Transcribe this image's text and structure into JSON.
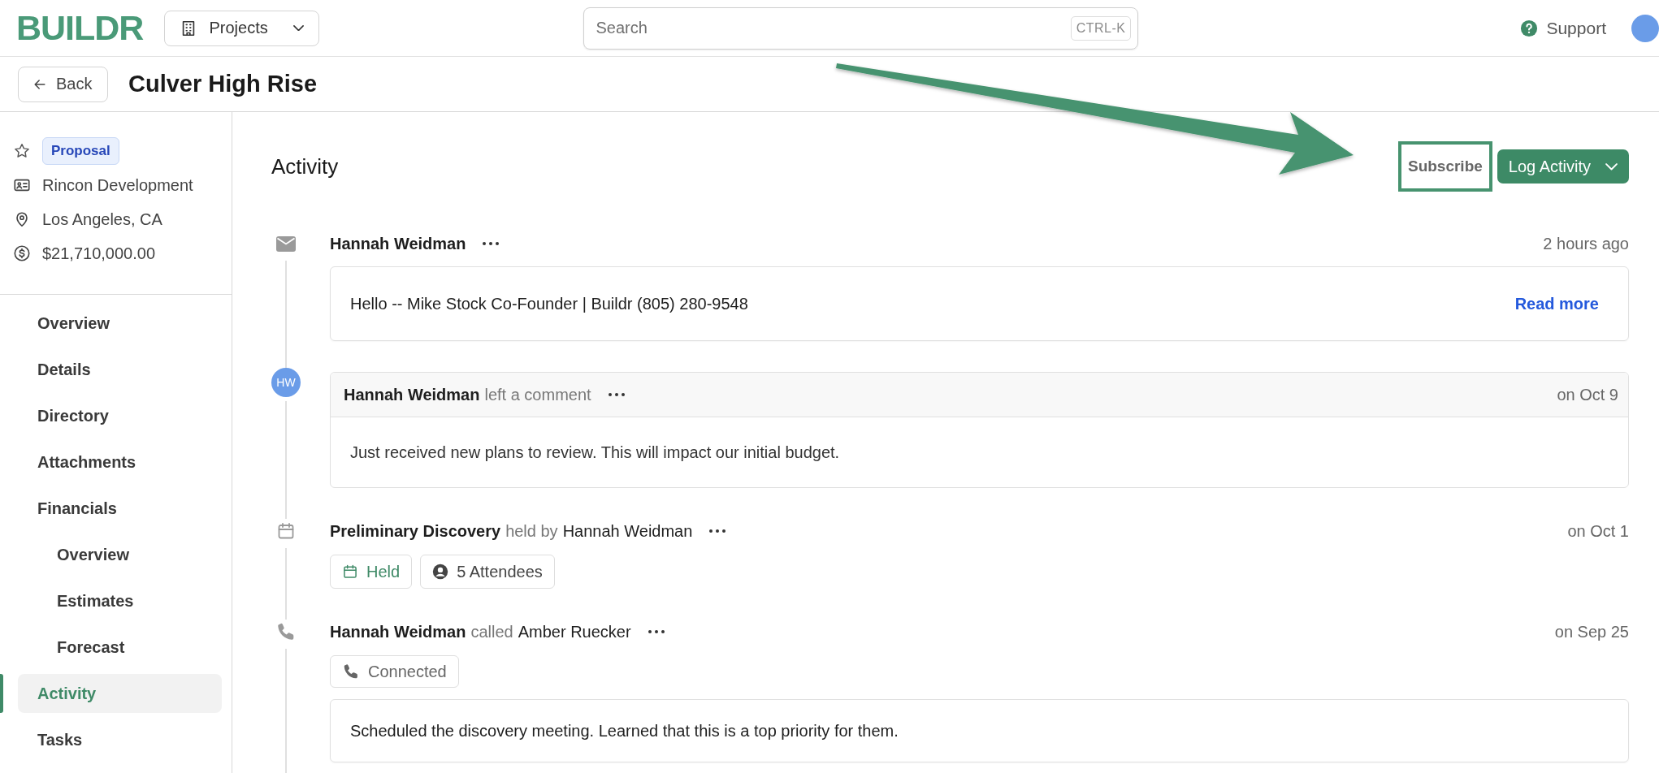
{
  "header": {
    "logo": "BUILDR",
    "projects_menu": "Projects",
    "search": {
      "placeholder": "Search",
      "shortcut": "CTRL-K"
    },
    "support": "Support"
  },
  "page": {
    "back": "Back",
    "title": "Culver High Rise"
  },
  "sidebar": {
    "starred": false,
    "status": "Proposal",
    "company": "Rincon Development",
    "location": "Los Angeles, CA",
    "value": "$21,710,000.00",
    "items": [
      {
        "label": "Overview",
        "selected": false
      },
      {
        "label": "Details",
        "selected": false
      },
      {
        "label": "Directory",
        "selected": false
      },
      {
        "label": "Attachments",
        "selected": false
      },
      {
        "label": "Financials",
        "selected": false,
        "children": [
          {
            "label": "Overview",
            "selected": false
          },
          {
            "label": "Estimates",
            "selected": false
          },
          {
            "label": "Forecast",
            "selected": false
          }
        ]
      },
      {
        "label": "Activity",
        "selected": true
      },
      {
        "label": "Tasks",
        "selected": false
      }
    ]
  },
  "activity": {
    "title": "Activity",
    "subscribe": "Subscribe",
    "log_button": "Log Activity",
    "entries": [
      {
        "kind": "email",
        "author": "Hannah Weidman",
        "time": "2 hours ago",
        "body": "Hello -- Mike Stock Co-Founder | Buildr (805) 280-9548",
        "link": "Read more"
      },
      {
        "kind": "comment",
        "initials": "HW",
        "author": "Hannah Weidman",
        "action": "left a comment",
        "time": "on Oct 9",
        "body": "Just received new plans to review. This will impact our initial budget."
      },
      {
        "kind": "meeting",
        "author": "Preliminary Discovery",
        "action": "held by",
        "person": "Hannah Weidman",
        "time": "on Oct 1",
        "chips": [
          {
            "kind": "held",
            "label": "Held"
          },
          {
            "kind": "attendees",
            "label": "5 Attendees"
          }
        ]
      },
      {
        "kind": "call",
        "author": "Hannah Weidman",
        "action": "called",
        "person": "Amber Ruecker",
        "time": "on Sep 25",
        "chips": [
          {
            "kind": "connected",
            "label": "Connected"
          }
        ],
        "body": "Scheduled the discovery meeting. Learned that this is a top priority for them."
      }
    ]
  }
}
